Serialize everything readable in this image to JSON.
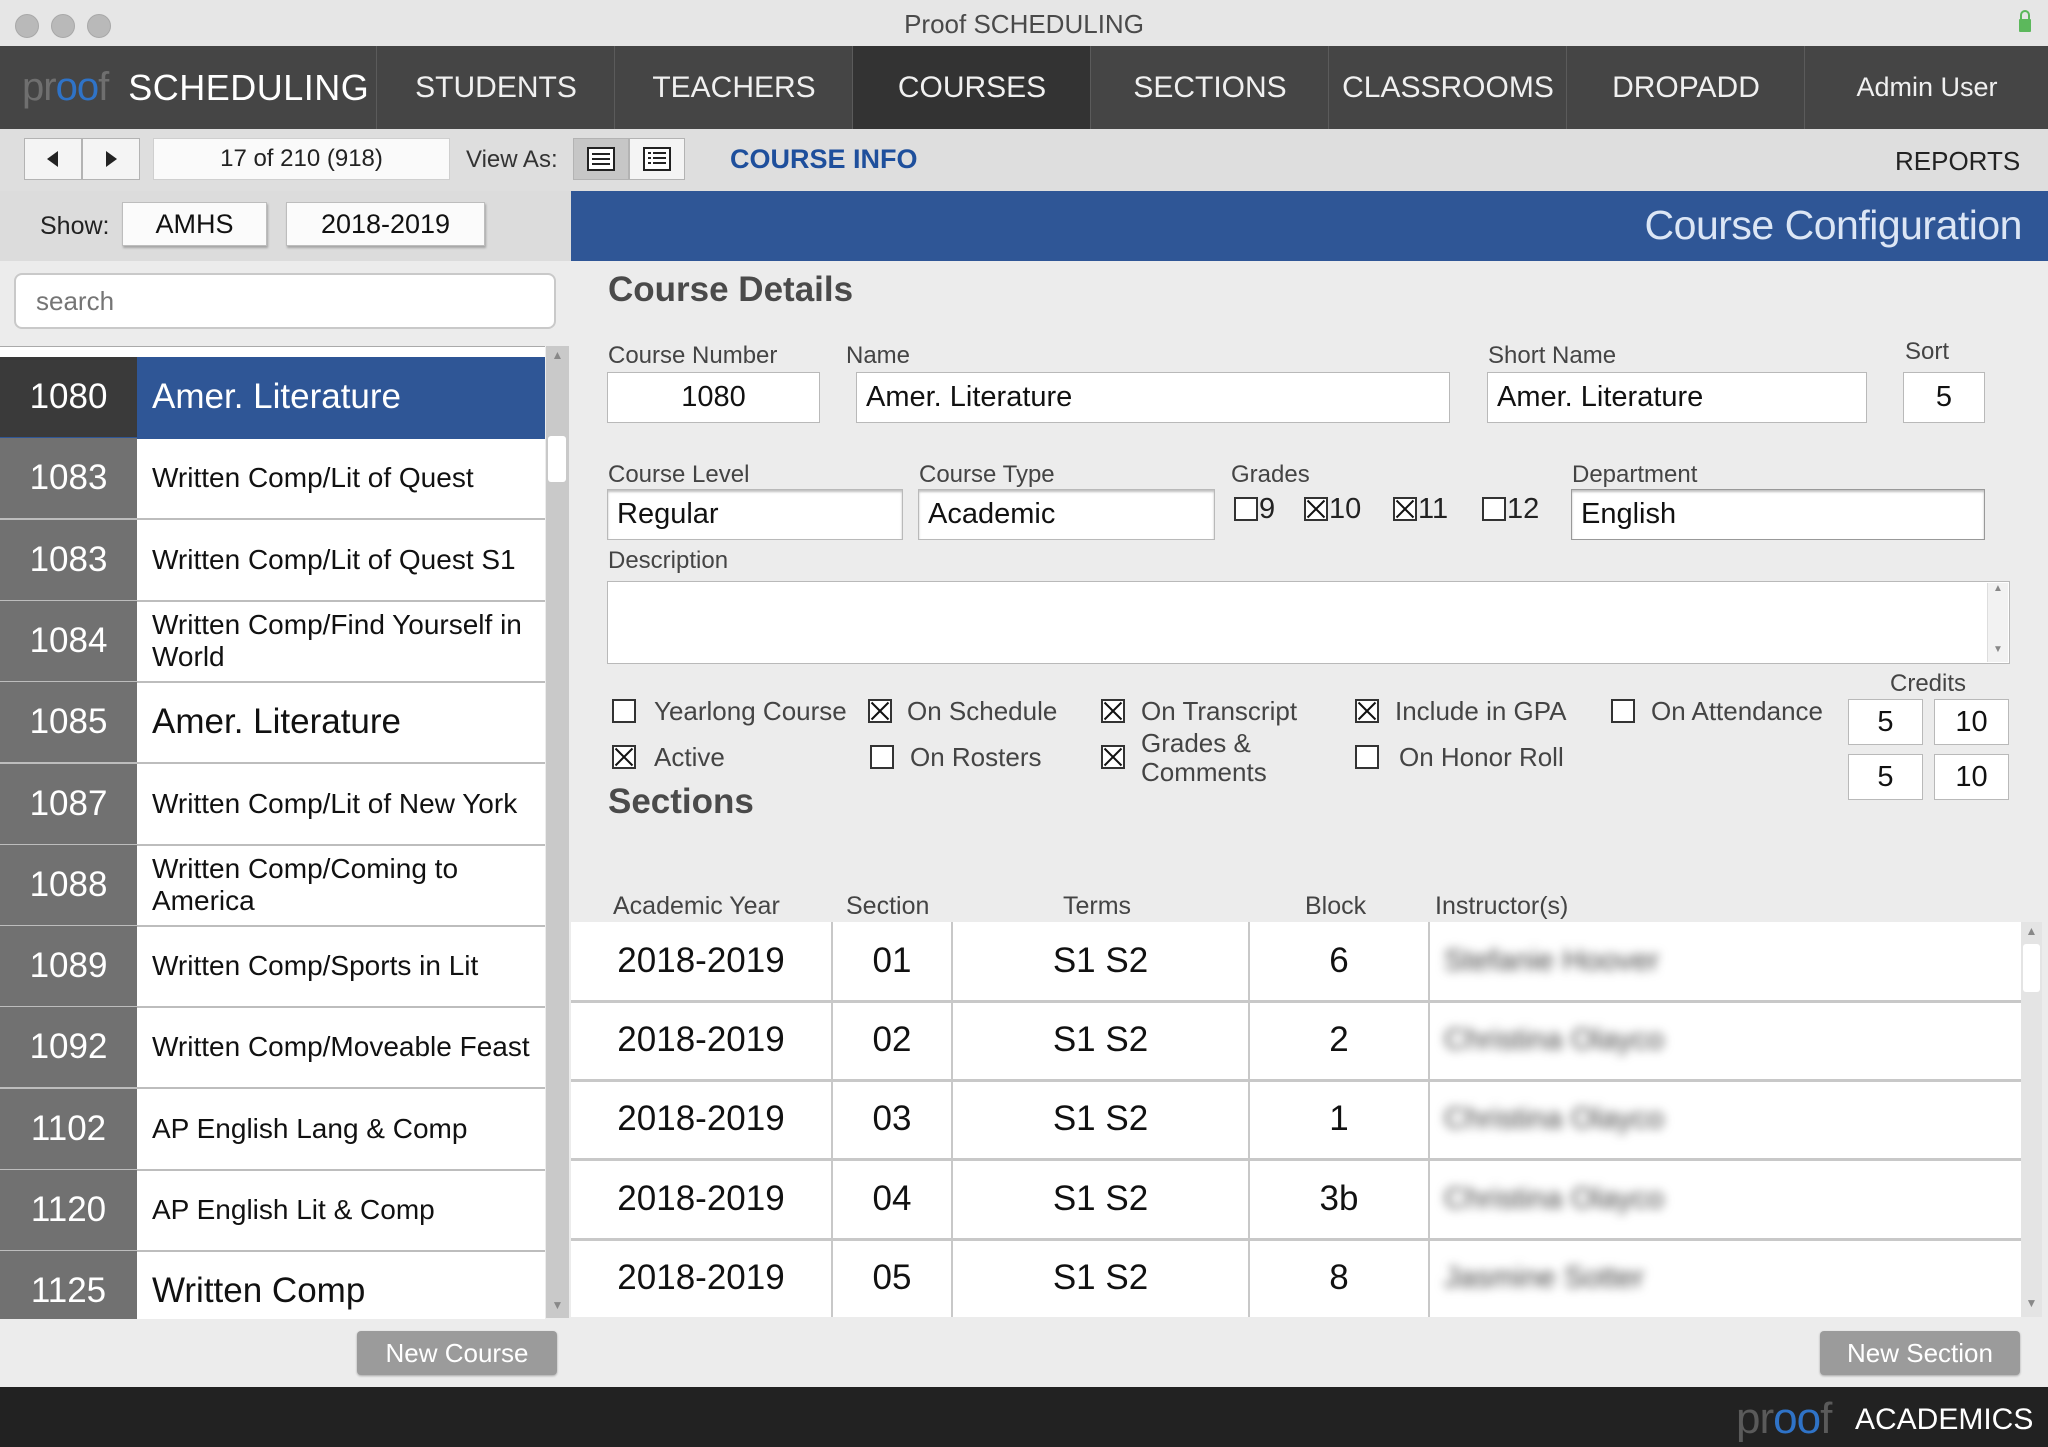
{
  "window": {
    "title": "Proof SCHEDULING"
  },
  "brand": {
    "logo_a": "pr",
    "logo_b": "oo",
    "logo_c": "f",
    "app": "SCHEDULING"
  },
  "nav": {
    "items": [
      "STUDENTS",
      "TEACHERS",
      "COURSES",
      "SECTIONS",
      "CLASSROOMS",
      "DROPADD",
      "Admin User"
    ],
    "active": "COURSES"
  },
  "toolbar": {
    "record": "17 of 210 (918)",
    "view_as": "View As:",
    "course_info": "COURSE INFO",
    "reports": "REPORTS"
  },
  "show": {
    "label": "Show:",
    "school": "AMHS",
    "year": "2018-2019"
  },
  "header": {
    "title": "Course Configuration"
  },
  "search": {
    "placeholder": "search"
  },
  "courses": [
    {
      "num": "1080",
      "name": "Amer. Literature",
      "selected": true,
      "big": true
    },
    {
      "num": "1083",
      "name": "Written Comp/Lit of Quest"
    },
    {
      "num": "1083",
      "name": "Written Comp/Lit of Quest S1"
    },
    {
      "num": "1084",
      "name": "Written Comp/Find Yourself in World"
    },
    {
      "num": "1085",
      "name": "Amer. Literature",
      "big": true
    },
    {
      "num": "1087",
      "name": "Written Comp/Lit of New York"
    },
    {
      "num": "1088",
      "name": "Written Comp/Coming to America"
    },
    {
      "num": "1089",
      "name": "Written Comp/Sports in Lit"
    },
    {
      "num": "1092",
      "name": "Written Comp/Moveable Feast"
    },
    {
      "num": "1102",
      "name": "AP English Lang & Comp"
    },
    {
      "num": "1120",
      "name": "AP English Lit & Comp"
    },
    {
      "num": "1125",
      "name": "Written Comp",
      "big": true
    }
  ],
  "buttons": {
    "new_course": "New Course",
    "new_section": "New Section"
  },
  "details": {
    "heading": "Course Details",
    "course_number_label": "Course Number",
    "course_number": "1080",
    "name_label": "Name",
    "name": "Amer. Literature",
    "short_name_label": "Short Name",
    "short_name": "Amer. Literature",
    "sort_label": "Sort",
    "sort": "5",
    "course_level_label": "Course Level",
    "course_level": "Regular",
    "course_type_label": "Course Type",
    "course_type": "Academic",
    "grades_label": "Grades",
    "grades": [
      {
        "label": "9",
        "checked": false
      },
      {
        "label": "10",
        "checked": true
      },
      {
        "label": "11",
        "checked": true
      },
      {
        "label": "12",
        "checked": false
      }
    ],
    "department_label": "Department",
    "department": "English",
    "description_label": "Description",
    "description": "",
    "flags": {
      "yearlong": {
        "label": "Yearlong Course",
        "checked": false
      },
      "on_schedule": {
        "label": "On Schedule",
        "checked": true
      },
      "on_transcript": {
        "label": "On Transcript",
        "checked": true
      },
      "include_gpa": {
        "label": "Include in GPA",
        "checked": true
      },
      "on_attendance": {
        "label": "On Attendance",
        "checked": false
      },
      "active": {
        "label": "Active",
        "checked": true
      },
      "on_rosters": {
        "label": "On Rosters",
        "checked": false
      },
      "grades_comments": {
        "label_1": "Grades &",
        "label_2": "Comments",
        "checked": true
      },
      "on_honor_roll": {
        "label": "On Honor Roll",
        "checked": false
      }
    },
    "credits_label": "Credits",
    "credits": [
      "5",
      "10",
      "5",
      "10"
    ]
  },
  "sections": {
    "heading": "Sections",
    "columns": [
      "Academic Year",
      "Section",
      "Terms",
      "Block",
      "Instructor(s)"
    ],
    "rows": [
      {
        "year": "2018-2019",
        "section": "01",
        "terms": "S1 S2",
        "block": "6",
        "instructor": "Stefanie Hoover"
      },
      {
        "year": "2018-2019",
        "section": "02",
        "terms": "S1 S2",
        "block": "2",
        "instructor": "Christina Olayco"
      },
      {
        "year": "2018-2019",
        "section": "03",
        "terms": "S1 S2",
        "block": "1",
        "instructor": "Christina Olayco"
      },
      {
        "year": "2018-2019",
        "section": "04",
        "terms": "S1 S2",
        "block": "3b",
        "instructor": "Christina Olayco"
      },
      {
        "year": "2018-2019",
        "section": "05",
        "terms": "S1 S2",
        "block": "8",
        "instructor": "Jasmine Sotter"
      }
    ]
  },
  "footer": {
    "logo_a": "pr",
    "logo_b": "oo",
    "logo_c": "f",
    "app": "ACADEMICS"
  },
  "colors": {
    "accent": "#2f5696",
    "link": "#1e4f9c",
    "nav_bg": "#454545",
    "footer_bg": "#222222"
  }
}
